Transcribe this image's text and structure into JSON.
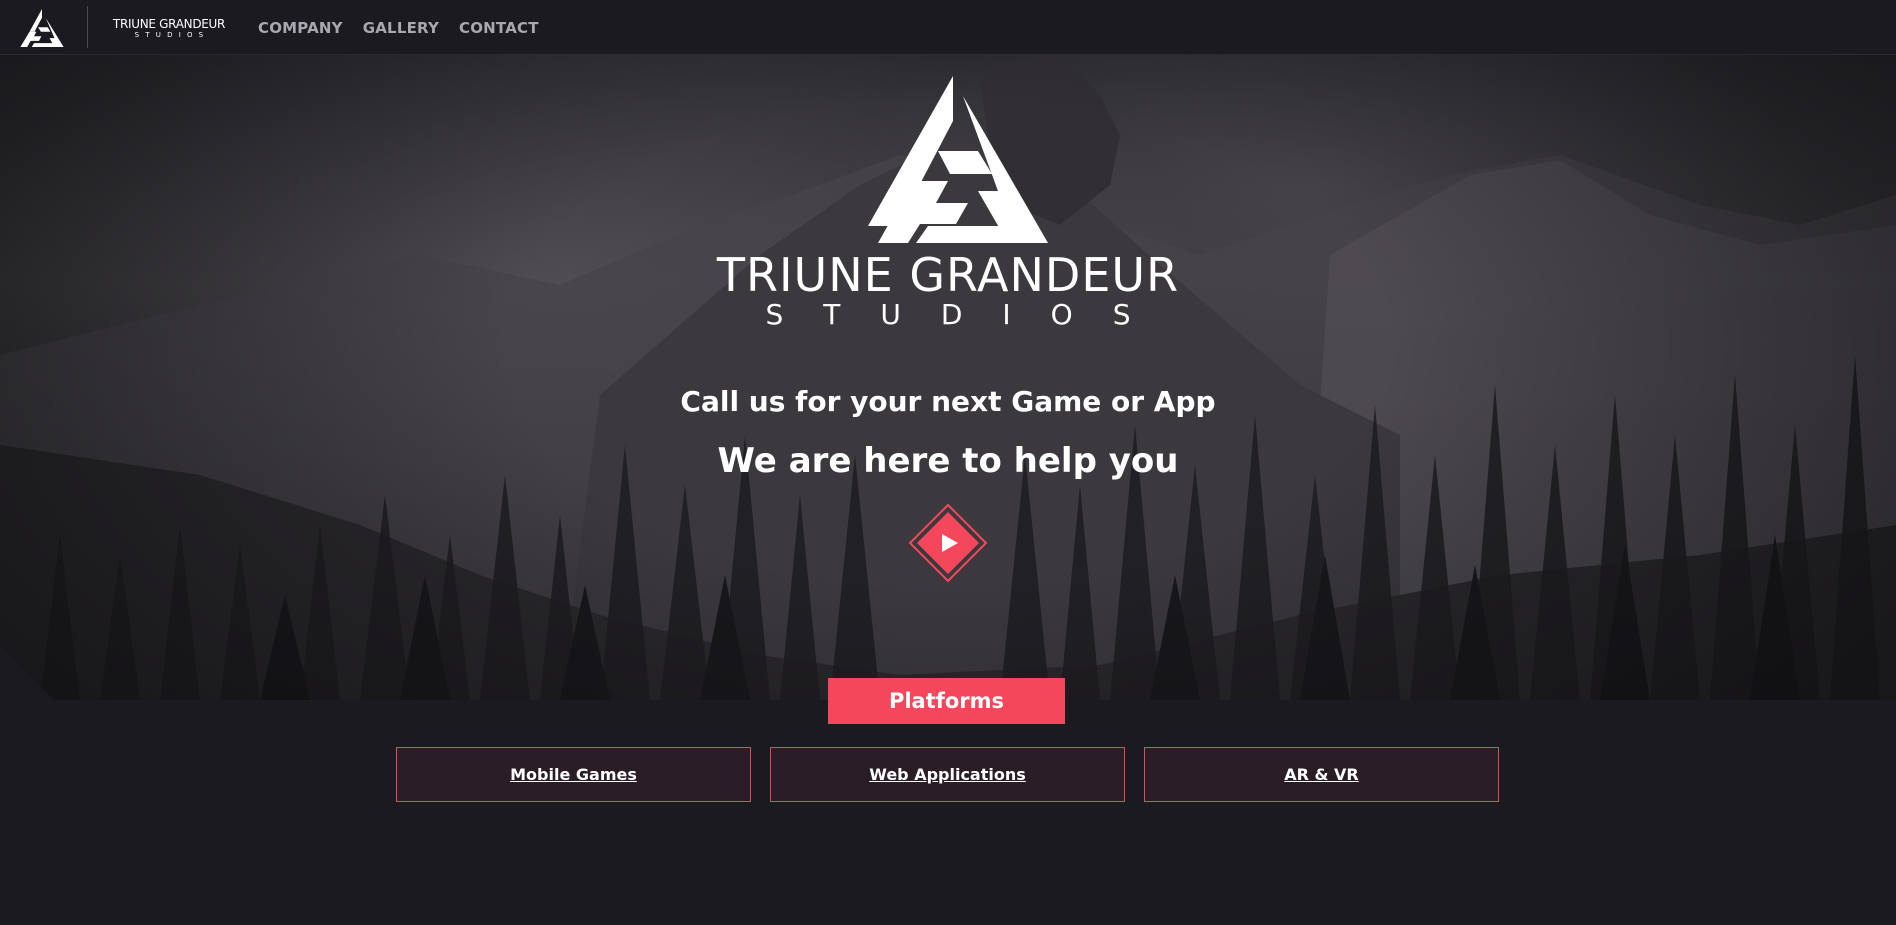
{
  "nav": {
    "brand_top": "TRIUNE GRANDEUR",
    "brand_bottom": "STUDIOS",
    "links": [
      "COMPANY",
      "GALLERY",
      "CONTACT"
    ],
    "logo_icon": "triune-logo-icon"
  },
  "hero": {
    "title": "TRIUNE GRANDEUR",
    "subtitle": "STUDIOS",
    "line1": "Call us for your next Game or App",
    "line2": "We are here to help you",
    "play_icon": "play-icon"
  },
  "platforms": {
    "label": "Platforms",
    "items": [
      "Mobile Games",
      "Web Applications",
      "AR & VR"
    ]
  },
  "colors": {
    "accent": "#f4475b",
    "background": "#1b1a21",
    "card_bg": "#2b1d25",
    "nav_link": "#a9a8ae"
  }
}
